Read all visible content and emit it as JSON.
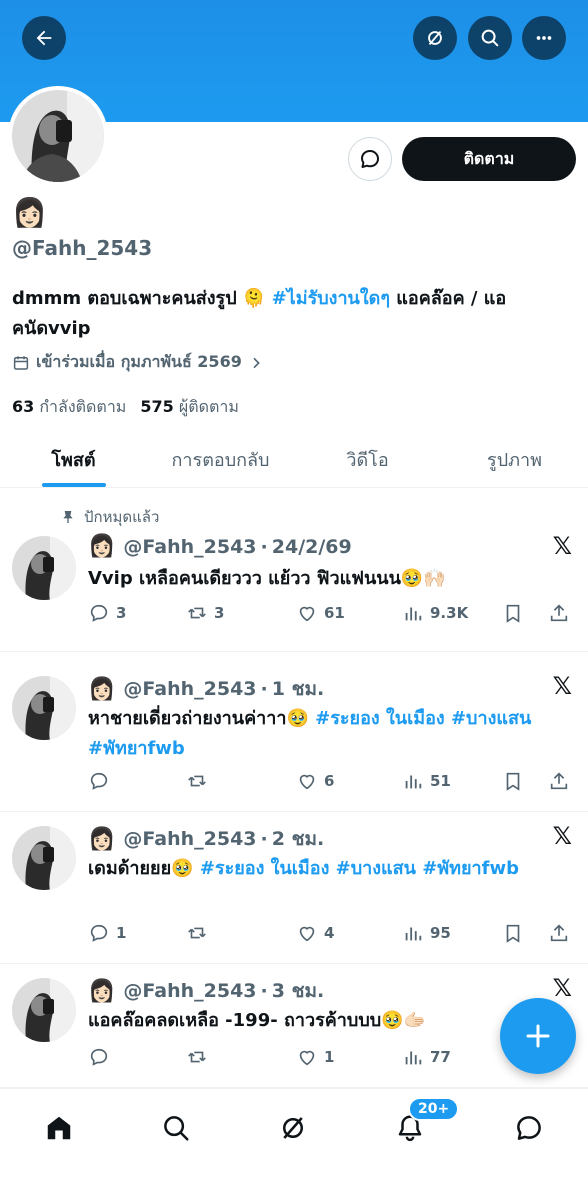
{
  "profile": {
    "emoji": "👩🏻",
    "handle": "@Fahh_2543",
    "bio_start": "dmmm ตอบเฉพาะคนส่งรูป 🫠 ",
    "bio_tag": "#ไม่รับงานใดๆ",
    "bio_end": " แอคล๊อค / แอคนัดvvip",
    "joined": "เข้าร่วมเมื่อ กุมภาพันธ์ 2569",
    "following_count": "63",
    "following_label": "กำลังติดตาม",
    "followers_count": "575",
    "followers_label": "ผู้ติดตาม",
    "follow_button": "ติดตาม"
  },
  "tabs": [
    {
      "label": "โพสต์"
    },
    {
      "label": "การตอบกลับ"
    },
    {
      "label": "วิดีโอ"
    },
    {
      "label": "รูปภาพ"
    }
  ],
  "pinned_label": "ปักหมุดแล้ว",
  "posts": [
    {
      "emoji": "👩🏻",
      "handle": "@Fahh_2543",
      "time": "24/2/69",
      "text_plain": "Vvip เหลือคนเดียววว แย้วว ฟิวแฟนนน🥹🙌🏻",
      "tags": "",
      "replies": "3",
      "reposts": "3",
      "likes": "61",
      "views": "9.3K"
    },
    {
      "emoji": "👩🏻",
      "handle": "@Fahh_2543",
      "time": "1 ชม.",
      "text_plain": "หาชายเดี่ยวถ่ายงานค่าาา🥹 ",
      "tags": "#ระยอง ในเมือง #บางแสน #พัทยาfwb",
      "replies": "",
      "reposts": "",
      "likes": "6",
      "views": "51"
    },
    {
      "emoji": "👩🏻",
      "handle": "@Fahh_2543",
      "time": "2 ชม.",
      "text_plain": "เดมด้ายยย🥹 ",
      "tags": "#ระยอง ในเมือง #บางแสน #พัทยาfwb",
      "replies": "1",
      "reposts": "",
      "likes": "4",
      "views": "95"
    },
    {
      "emoji": "👩🏻",
      "handle": "@Fahh_2543",
      "time": "3 ชม.",
      "text_plain": "แอคล๊อคลดเหลือ -199- ถาวรค้าบบบ🥹🫱🏻",
      "tags": "",
      "replies": "",
      "reposts": "",
      "likes": "1",
      "views": "77"
    }
  ],
  "notifications_badge": "20+",
  "x_logo": "𝕏",
  "colors": {
    "accent": "#1d9bf0",
    "text": "#0f1419",
    "muted": "#536471"
  }
}
